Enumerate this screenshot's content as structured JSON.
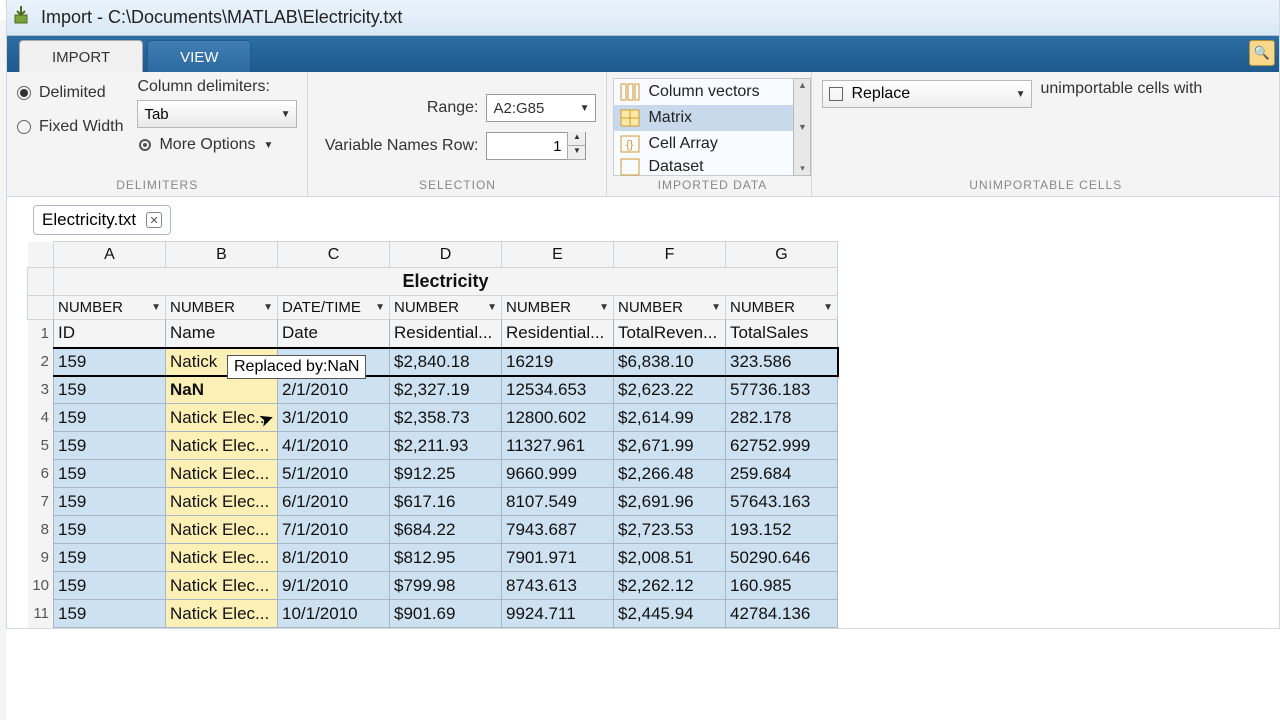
{
  "window": {
    "title": "Import - C:\\Documents\\MATLAB\\Electricity.txt"
  },
  "tabs": {
    "import": "IMPORT",
    "view": "VIEW"
  },
  "delimiters": {
    "delimited_label": "Delimited",
    "fixedwidth_label": "Fixed Width",
    "column_label": "Column delimiters:",
    "delimiter_value": "Tab",
    "more_options": "More Options",
    "group_label": "DELIMITERS"
  },
  "selection": {
    "range_label": "Range:",
    "range_value": "A2:G85",
    "varrow_label": "Variable Names Row:",
    "varrow_value": "1",
    "group_label": "SELECTION"
  },
  "imported": {
    "items": [
      "Column vectors",
      "Matrix",
      "Cell Array",
      "Dataset"
    ],
    "group_label": "IMPORTED DATA"
  },
  "unimportable": {
    "replace_label": "Replace",
    "tail_text": "unimportable cells with",
    "group_label": "UNIMPORTABLE CELLS"
  },
  "file_tab": {
    "name": "Electricity.txt"
  },
  "grid": {
    "title": "Electricity",
    "col_letters": [
      "A",
      "B",
      "C",
      "D",
      "E",
      "F",
      "G"
    ],
    "col_types": [
      "NUMBER",
      "NUMBER",
      "DATE/TIME",
      "NUMBER",
      "NUMBER",
      "NUMBER",
      "NUMBER"
    ],
    "headers": [
      "ID",
      "Name",
      "Date",
      "Residential...",
      "Residential...",
      "TotalReven...",
      "TotalSales"
    ],
    "tooltip": "Replaced by:NaN",
    "rows": [
      {
        "n": 2,
        "id": "159",
        "name": "Natick",
        "date": "",
        "res": "$2,840.18",
        "res2": "16219",
        "totr": "$6,838.10",
        "tots": "323.586",
        "yellow": true,
        "name_full": "Natick"
      },
      {
        "n": 3,
        "id": "159",
        "name": "NaN",
        "date": "2/1/2010",
        "res": "$2,327.19",
        "res2": "12534.653",
        "totr": "$2,623.22",
        "tots": "57736.183",
        "yellow": true,
        "nan": true
      },
      {
        "n": 4,
        "id": "159",
        "name": "Natick Elec...",
        "date": "3/1/2010",
        "res": "$2,358.73",
        "res2": "12800.602",
        "totr": "$2,614.99",
        "tots": "282.178",
        "yellow": true
      },
      {
        "n": 5,
        "id": "159",
        "name": "Natick Elec...",
        "date": "4/1/2010",
        "res": "$2,211.93",
        "res2": "11327.961",
        "totr": "$2,671.99",
        "tots": "62752.999",
        "yellow": true
      },
      {
        "n": 6,
        "id": "159",
        "name": "Natick Elec...",
        "date": "5/1/2010",
        "res": "$912.25",
        "res2": "9660.999",
        "totr": "$2,266.48",
        "tots": "259.684",
        "yellow": true
      },
      {
        "n": 7,
        "id": "159",
        "name": "Natick Elec...",
        "date": "6/1/2010",
        "res": "$617.16",
        "res2": "8107.549",
        "totr": "$2,691.96",
        "tots": "57643.163",
        "yellow": true
      },
      {
        "n": 8,
        "id": "159",
        "name": "Natick Elec...",
        "date": "7/1/2010",
        "res": "$684.22",
        "res2": "7943.687",
        "totr": "$2,723.53",
        "tots": "193.152",
        "yellow": true
      },
      {
        "n": 9,
        "id": "159",
        "name": "Natick Elec...",
        "date": "8/1/2010",
        "res": "$812.95",
        "res2": "7901.971",
        "totr": "$2,008.51",
        "tots": "50290.646",
        "yellow": true
      },
      {
        "n": 10,
        "id": "159",
        "name": "Natick Elec...",
        "date": "9/1/2010",
        "res": "$799.98",
        "res2": "8743.613",
        "totr": "$2,262.12",
        "tots": "160.985",
        "yellow": true
      },
      {
        "n": 11,
        "id": "159",
        "name": "Natick Elec...",
        "date": "10/1/2010",
        "res": "$901.69",
        "res2": "9924.711",
        "totr": "$2,445.94",
        "tots": "42784.136",
        "yellow": true
      }
    ]
  }
}
